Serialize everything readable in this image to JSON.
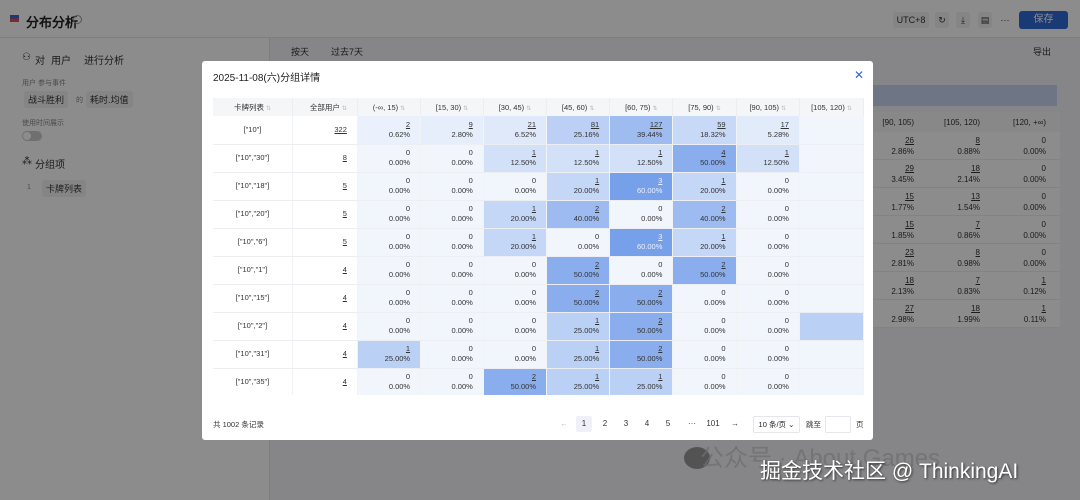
{
  "header": {
    "title": "分布分析",
    "timezone": "UTC+8",
    "save_label": "保存"
  },
  "sidebar": {
    "analyze_prefix": "对",
    "analyze_subject": "用户",
    "analyze_suffix": "进行分析",
    "event_label": "用户 参与事件",
    "event": "战斗胜利",
    "event_of": "的",
    "metric": "耗时.均值",
    "toggle_label": "使用时间展示",
    "group_title": "分组项",
    "group_index": "1",
    "group_item": "卡牌列表"
  },
  "toolbar": {
    "granularity": "按天",
    "range": "过去7天",
    "export": "导出"
  },
  "background_table": {
    "headers": [
      "[90, 105)",
      "[105, 120)",
      "[120, +∞)"
    ],
    "rows": [
      [
        [
          "26",
          "2.86%"
        ],
        [
          "8",
          "0.88%"
        ],
        [
          "0",
          "0.00%"
        ]
      ],
      [
        [
          "29",
          "3.45%"
        ],
        [
          "18",
          "2.14%"
        ],
        [
          "0",
          "0.00%"
        ]
      ],
      [
        [
          "15",
          "1.77%"
        ],
        [
          "13",
          "1.54%"
        ],
        [
          "0",
          "0.00%"
        ]
      ],
      [
        [
          "15",
          "1.85%"
        ],
        [
          "7",
          "0.86%"
        ],
        [
          "0",
          "0.00%"
        ]
      ],
      [
        [
          "23",
          "2.81%"
        ],
        [
          "8",
          "0.98%"
        ],
        [
          "0",
          "0.00%"
        ]
      ],
      [
        [
          "18",
          "2.13%"
        ],
        [
          "7",
          "0.83%"
        ],
        [
          "1",
          "0.12%"
        ]
      ],
      [
        [
          "27",
          "2.98%"
        ],
        [
          "18",
          "1.99%"
        ],
        [
          "1",
          "0.11%"
        ]
      ]
    ]
  },
  "modal": {
    "title": "2025-11-08(六)分组详情",
    "columns": [
      "卡牌列表",
      "全部用户",
      "(-∞, 15)",
      "[15, 30)",
      "[30, 45)",
      "[45, 60)",
      "[60, 75)",
      "[75, 90)",
      "[90, 105)",
      "[105, 120)"
    ],
    "rows": [
      {
        "key": "[\"10\"]",
        "total": "322",
        "counts": [
          2,
          9,
          21,
          81,
          127,
          59,
          17
        ],
        "pcts": [
          "0.62%",
          "2.80%",
          "6.52%",
          "25.16%",
          "39.44%",
          "18.32%",
          "5.28%"
        ]
      },
      {
        "key": "[\"10\",\"30\"]",
        "total": "8",
        "counts": [
          0,
          0,
          1,
          1,
          1,
          4,
          1
        ],
        "pcts": [
          "0.00%",
          "0.00%",
          "12.50%",
          "12.50%",
          "12.50%",
          "50.00%",
          "12.50%"
        ]
      },
      {
        "key": "[\"10\",\"18\"]",
        "total": "5",
        "counts": [
          0,
          0,
          0,
          1,
          3,
          1,
          0
        ],
        "pcts": [
          "0.00%",
          "0.00%",
          "0.00%",
          "20.00%",
          "60.00%",
          "20.00%",
          "0.00%"
        ]
      },
      {
        "key": "[\"10\",\"20\"]",
        "total": "5",
        "counts": [
          0,
          0,
          1,
          2,
          0,
          2,
          0
        ],
        "pcts": [
          "0.00%",
          "0.00%",
          "20.00%",
          "40.00%",
          "0.00%",
          "40.00%",
          "0.00%"
        ]
      },
      {
        "key": "[\"10\",\"6\"]",
        "total": "5",
        "counts": [
          0,
          0,
          1,
          0,
          3,
          1,
          0
        ],
        "pcts": [
          "0.00%",
          "0.00%",
          "20.00%",
          "0.00%",
          "60.00%",
          "20.00%",
          "0.00%"
        ]
      },
      {
        "key": "[\"10\",\"1\"]",
        "total": "4",
        "counts": [
          0,
          0,
          0,
          2,
          0,
          2,
          0
        ],
        "pcts": [
          "0.00%",
          "0.00%",
          "0.00%",
          "50.00%",
          "0.00%",
          "50.00%",
          "0.00%"
        ]
      },
      {
        "key": "[\"10\",\"15\"]",
        "total": "4",
        "counts": [
          0,
          0,
          0,
          2,
          2,
          0,
          0
        ],
        "pcts": [
          "0.00%",
          "0.00%",
          "0.00%",
          "50.00%",
          "50.00%",
          "0.00%",
          "0.00%"
        ]
      },
      {
        "key": "[\"10\",\"2\"]",
        "total": "4",
        "counts": [
          0,
          0,
          0,
          1,
          2,
          0,
          0
        ],
        "pcts": [
          "0.00%",
          "0.00%",
          "0.00%",
          "25.00%",
          "50.00%",
          "0.00%",
          "0.00%"
        ]
      },
      {
        "key": "[\"10\",\"31\"]",
        "total": "4",
        "counts": [
          1,
          0,
          0,
          1,
          2,
          0,
          0
        ],
        "pcts": [
          "25.00%",
          "0.00%",
          "0.00%",
          "25.00%",
          "50.00%",
          "0.00%",
          "0.00%"
        ]
      },
      {
        "key": "[\"10\",\"35\"]",
        "total": "4",
        "counts": [
          0,
          0,
          2,
          1,
          1,
          0,
          0
        ],
        "pcts": [
          "0.00%",
          "0.00%",
          "50.00%",
          "25.00%",
          "25.00%",
          "0.00%",
          "0.00%"
        ]
      }
    ],
    "truncated_col_pct": [
      0,
      0,
      0,
      0,
      0,
      0,
      0,
      25,
      0,
      0
    ],
    "total_label": "共 1002 条记录",
    "pages": [
      "1",
      "2",
      "3",
      "4",
      "5",
      "···",
      "101"
    ],
    "page_size": "10 条/页",
    "jump_label": "跳至",
    "page_unit": "页",
    "accent": "#3466d6"
  },
  "watermark": {
    "line1": "公众号 · About Games",
    "line2": "掘金技术社区 @ ThinkingAI"
  }
}
